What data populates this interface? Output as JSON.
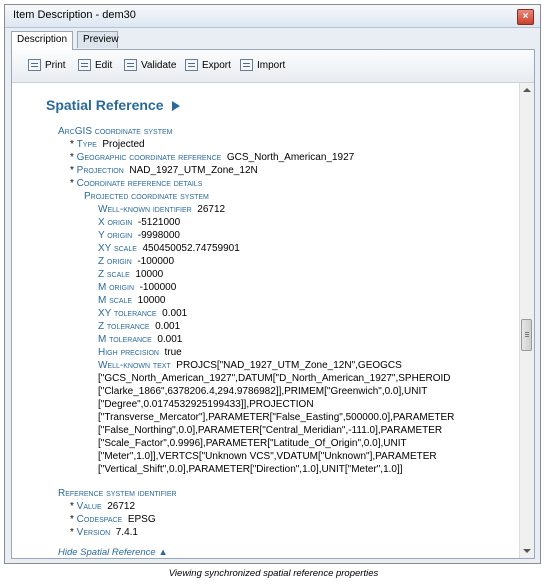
{
  "window": {
    "title": "Item Description - dem30",
    "close": "×"
  },
  "tabs": [
    {
      "label": "Description"
    },
    {
      "label": "Preview"
    }
  ],
  "toolbar": {
    "print": "Print",
    "edit": "Edit",
    "validate": "Validate",
    "export": "Export",
    "import": "Import"
  },
  "section": {
    "title": "Spatial Reference"
  },
  "lines": {
    "arcgis": "ArcGIS coordinate system",
    "type_k": "Type",
    "type_v": "Projected",
    "geo_k": "Geographic coordinate reference",
    "geo_v": "GCS_North_American_1927",
    "proj_k": "Projection",
    "proj_v": "NAD_1927_UTM_Zone_12N",
    "crd": "Coordinate reference details",
    "pcs": "Projected coordinate system",
    "wkid_k": "Well-known identifier",
    "wkid_v": "26712",
    "xo_k": "X origin",
    "xo_v": "-5121000",
    "yo_k": "Y origin",
    "yo_v": "-9998000",
    "xys_k": "XY scale",
    "xys_v": "450450052.74759901",
    "zo_k": "Z origin",
    "zo_v": "-100000",
    "zs_k": "Z scale",
    "zs_v": "10000",
    "mo_k": "M origin",
    "mo_v": "-100000",
    "ms_k": "M scale",
    "ms_v": "10000",
    "xyt_k": "XY tolerance",
    "xyt_v": "0.001",
    "zt_k": "Z tolerance",
    "zt_v": "0.001",
    "mt_k": "M tolerance",
    "mt_v": "0.001",
    "hp_k": "High precision",
    "hp_v": "true",
    "wkt_k": "Well-known text",
    "wkt_1": "PROJCS[\"NAD_1927_UTM_Zone_12N\",GEOGCS",
    "wkt_2": "[\"GCS_North_American_1927\",DATUM[\"D_North_American_1927\",SPHEROID",
    "wkt_3": "[\"Clarke_1866\",6378206.4,294.9786982]],PRIMEM[\"Greenwich\",0.0],UNIT",
    "wkt_4": "[\"Degree\",0.0174532925199433]],PROJECTION",
    "wkt_5": "[\"Transverse_Mercator\"],PARAMETER[\"False_Easting\",500000.0],PARAMETER",
    "wkt_6": "[\"False_Northing\",0.0],PARAMETER[\"Central_Meridian\",-111.0],PARAMETER",
    "wkt_7": "[\"Scale_Factor\",0.9996],PARAMETER[\"Latitude_Of_Origin\",0.0],UNIT",
    "wkt_8": "[\"Meter\",1.0]],VERTCS[\"Unknown VCS\",VDATUM[\"Unknown\"],PARAMETER",
    "wkt_9": "[\"Vertical_Shift\",0.0],PARAMETER[\"Direction\",1.0],UNIT[\"Meter\",1.0]]",
    "rsi": "Reference system identifier",
    "val_k": "Value",
    "val_v": "26712",
    "cs_k": "Codespace",
    "cs_v": "EPSG",
    "ver_k": "Version",
    "ver_v": "7.4.1"
  },
  "hide_link": "Hide Spatial Reference ▲",
  "caption": "Viewing synchronized spatial reference properties"
}
